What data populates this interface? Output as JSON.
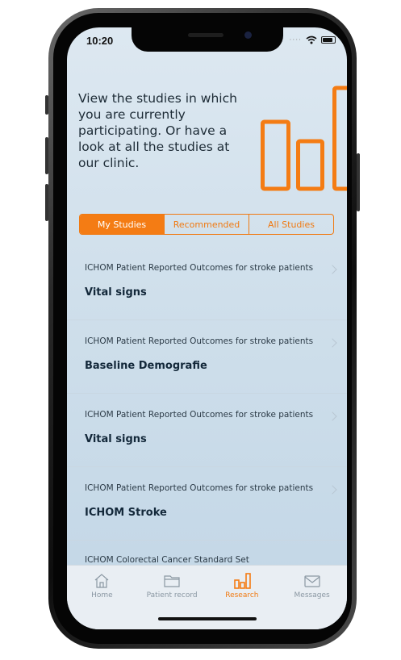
{
  "status_bar": {
    "time": "10:20"
  },
  "intro_text": "View the studies in which you are currently participating. Or have a look at all the studies at our clinic.",
  "colors": {
    "accent": "#f47c14",
    "screen_bg": "#d3e1ec"
  },
  "segments": [
    {
      "label": "My Studies",
      "active": true
    },
    {
      "label": "Recommended",
      "active": false
    },
    {
      "label": "All Studies",
      "active": false
    }
  ],
  "studies": [
    {
      "subtitle": "ICHOM Patient Reported Outcomes for stroke patients",
      "title": "Vital signs"
    },
    {
      "subtitle": "ICHOM Patient Reported Outcomes for stroke patients",
      "title": "Baseline Demografie"
    },
    {
      "subtitle": "ICHOM Patient Reported Outcomes for stroke patients",
      "title": "Vital signs"
    },
    {
      "subtitle": "ICHOM Patient Reported Outcomes for stroke patients",
      "title": "ICHOM Stroke"
    },
    {
      "subtitle": "ICHOM Colorectal Cancer Standard Set",
      "title": ""
    }
  ],
  "tabs": [
    {
      "label": "Home",
      "icon": "home-icon",
      "active": false
    },
    {
      "label": "Patient record",
      "icon": "folder-icon",
      "active": false
    },
    {
      "label": "Research",
      "icon": "bar-chart-icon",
      "active": true
    },
    {
      "label": "Messages",
      "icon": "envelope-icon",
      "active": false
    }
  ]
}
